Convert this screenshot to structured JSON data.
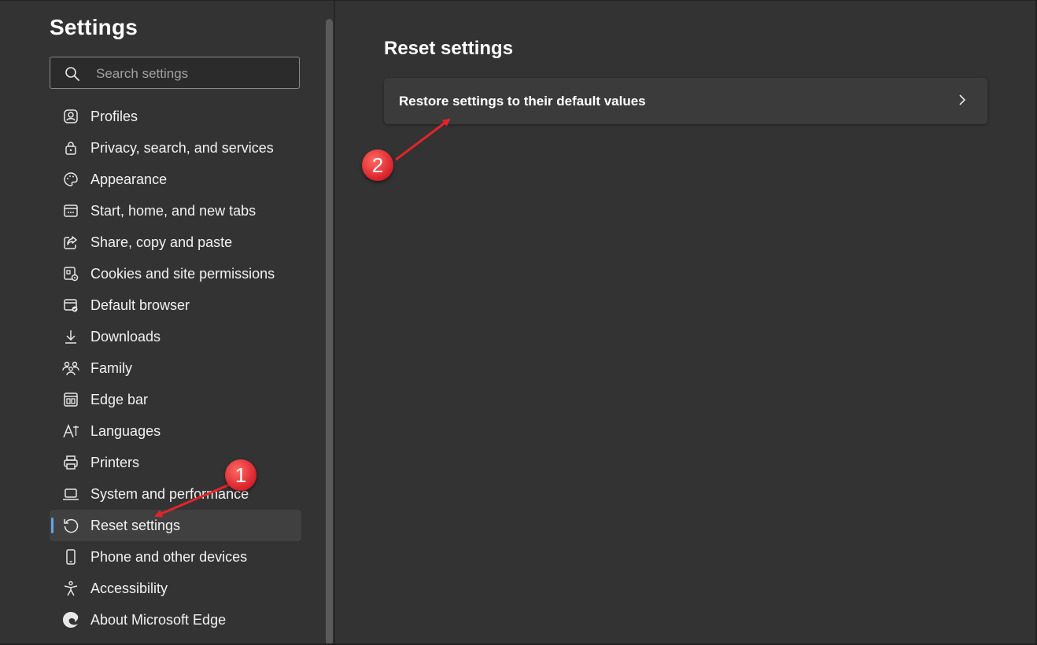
{
  "sidebar": {
    "title": "Settings",
    "search_placeholder": "Search settings",
    "items": [
      {
        "label": "Profiles",
        "icon": "profile-icon"
      },
      {
        "label": "Privacy, search, and services",
        "icon": "lock-icon"
      },
      {
        "label": "Appearance",
        "icon": "palette-icon"
      },
      {
        "label": "Start, home, and new tabs",
        "icon": "home-tabs-icon"
      },
      {
        "label": "Share, copy and paste",
        "icon": "share-icon"
      },
      {
        "label": "Cookies and site permissions",
        "icon": "cookies-icon"
      },
      {
        "label": "Default browser",
        "icon": "browser-icon"
      },
      {
        "label": "Downloads",
        "icon": "download-icon"
      },
      {
        "label": "Family",
        "icon": "family-icon"
      },
      {
        "label": "Edge bar",
        "icon": "edge-bar-icon"
      },
      {
        "label": "Languages",
        "icon": "languages-icon"
      },
      {
        "label": "Printers",
        "icon": "printer-icon"
      },
      {
        "label": "System and performance",
        "icon": "laptop-icon"
      },
      {
        "label": "Reset settings",
        "icon": "reset-icon",
        "active": true
      },
      {
        "label": "Phone and other devices",
        "icon": "phone-icon"
      },
      {
        "label": "Accessibility",
        "icon": "accessibility-icon"
      },
      {
        "label": "About Microsoft Edge",
        "icon": "edge-logo-icon"
      }
    ]
  },
  "main": {
    "title": "Reset settings",
    "card_label": "Restore settings to their default values"
  },
  "annotations": {
    "step1": "1",
    "step2": "2",
    "color": "#e3242b"
  },
  "colors": {
    "background": "#333333",
    "card": "#3b3b3b",
    "active_item": "#404040",
    "accent": "#60a8e8"
  }
}
